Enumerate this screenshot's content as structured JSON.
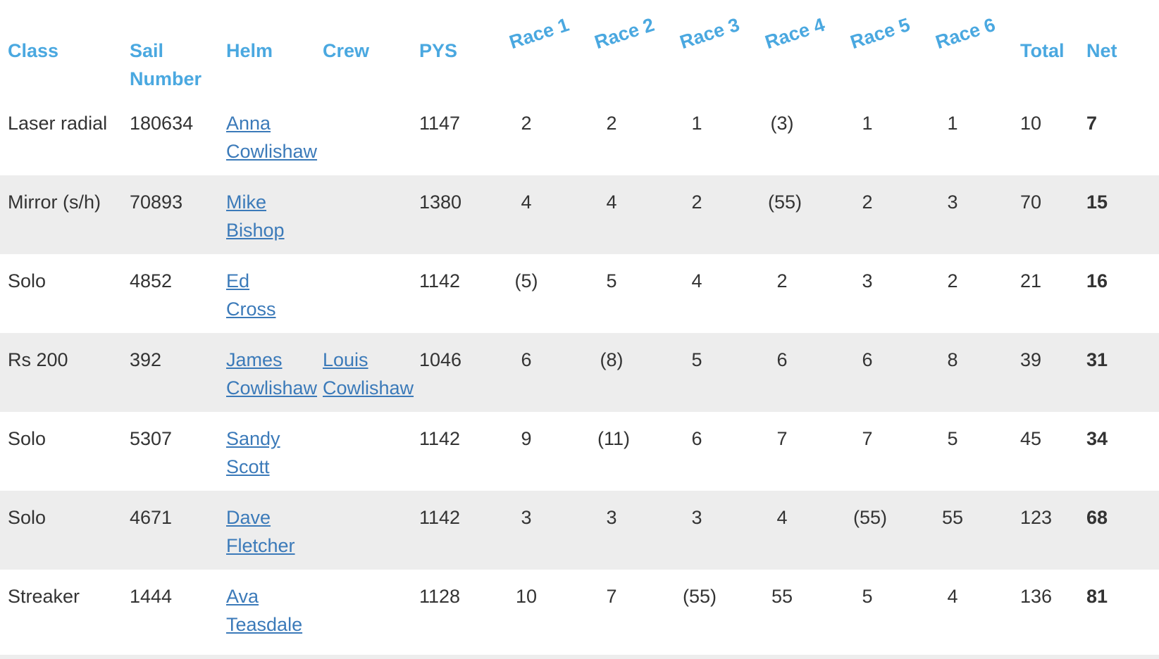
{
  "headers": {
    "class": "Class",
    "sail_line1": "Sail",
    "sail_line2": "Number",
    "helm": "Helm",
    "crew": "Crew",
    "pys": "PYS",
    "races": [
      "Race 1",
      "Race 2",
      "Race 3",
      "Race 4",
      "Race 5",
      "Race 6"
    ],
    "total": "Total",
    "net": "Net"
  },
  "colors": {
    "header": "#4aa8e0",
    "link": "#3b7ab9",
    "text": "#333333",
    "stripe": "#ededed"
  },
  "rows": [
    {
      "class": "Laser radial",
      "sail": "180634",
      "helm1": "Anna",
      "helm2": "Cowlishaw",
      "crew1": "",
      "crew2": "",
      "pys": "1147",
      "races": [
        "2",
        "2",
        "1",
        "(3)",
        "1",
        "1"
      ],
      "total": "10",
      "net": "7"
    },
    {
      "class": "Mirror (s/h)",
      "sail": "70893",
      "helm1": "Mike",
      "helm2": "Bishop",
      "crew1": "",
      "crew2": "",
      "pys": "1380",
      "races": [
        "4",
        "4",
        "2",
        "(55)",
        "2",
        "3"
      ],
      "total": "70",
      "net": "15"
    },
    {
      "class": "Solo",
      "sail": "4852",
      "helm1": "Ed",
      "helm2": "Cross",
      "crew1": "",
      "crew2": "",
      "pys": "1142",
      "races": [
        "(5)",
        "5",
        "4",
        "2",
        "3",
        "2"
      ],
      "total": "21",
      "net": "16"
    },
    {
      "class": "Rs 200",
      "sail": "392",
      "helm1": "James",
      "helm2": "Cowlishaw",
      "crew1": "Louis",
      "crew2": "Cowlishaw",
      "pys": "1046",
      "races": [
        "6",
        "(8)",
        "5",
        "6",
        "6",
        "8"
      ],
      "total": "39",
      "net": "31"
    },
    {
      "class": "Solo",
      "sail": "5307",
      "helm1": "Sandy",
      "helm2": "Scott",
      "crew1": "",
      "crew2": "",
      "pys": "1142",
      "races": [
        "9",
        "(11)",
        "6",
        "7",
        "7",
        "5"
      ],
      "total": "45",
      "net": "34"
    },
    {
      "class": "Solo",
      "sail": "4671",
      "helm1": "Dave",
      "helm2": "Fletcher",
      "crew1": "",
      "crew2": "",
      "pys": "1142",
      "races": [
        "3",
        "3",
        "3",
        "4",
        "(55)",
        "55"
      ],
      "total": "123",
      "net": "68"
    },
    {
      "class": "Streaker",
      "sail": "1444",
      "helm1": "Ava",
      "helm2": "Teasdale",
      "crew1": "",
      "crew2": "",
      "pys": "1128",
      "races": [
        "10",
        "7",
        "(55)",
        "55",
        "5",
        "4"
      ],
      "total": "136",
      "net": "81"
    }
  ]
}
